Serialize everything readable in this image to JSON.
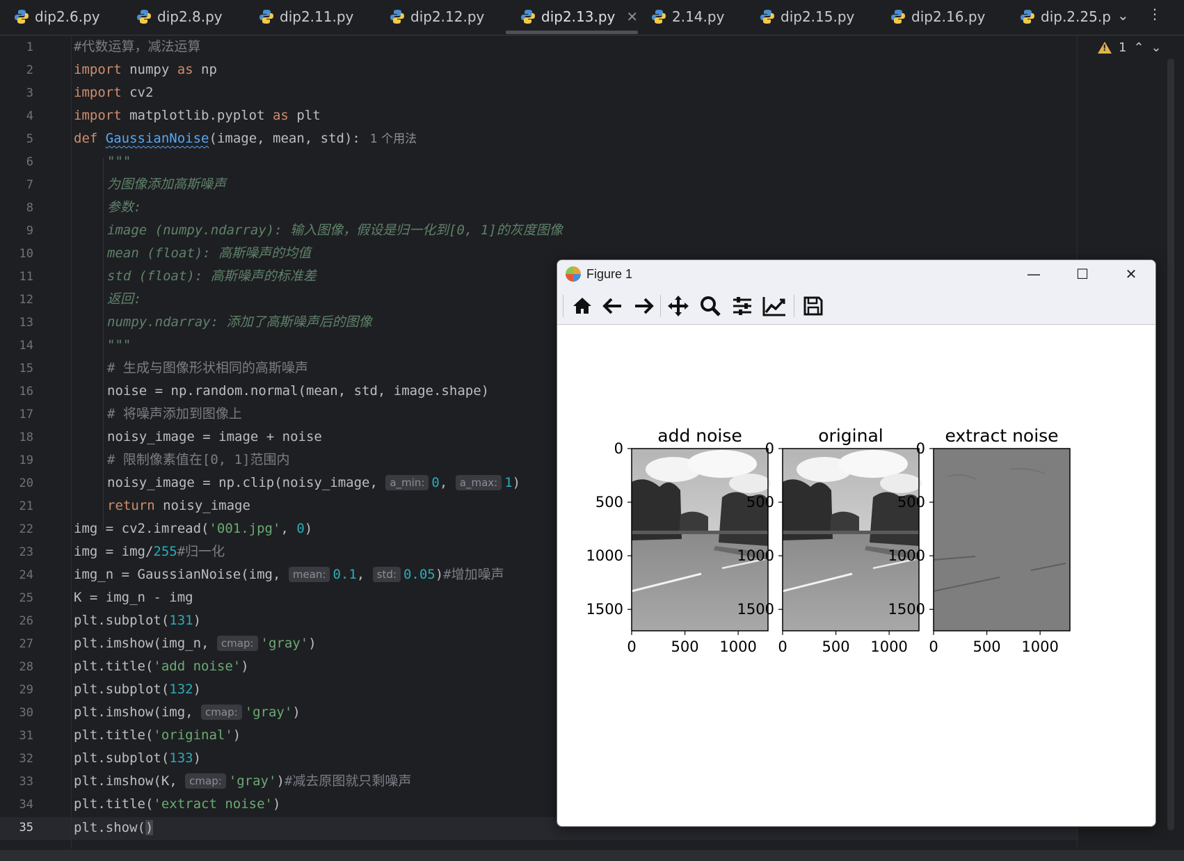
{
  "tabs": [
    {
      "label": "dip2.6.py",
      "active": false
    },
    {
      "label": "dip2.8.py",
      "active": false
    },
    {
      "label": "dip2.11.py",
      "active": false
    },
    {
      "label": "dip2.12.py",
      "active": false
    },
    {
      "label": "dip2.13.py",
      "active": true
    },
    {
      "label": "2.14.py",
      "active": false
    },
    {
      "label": "dip2.15.py",
      "active": false
    },
    {
      "label": "dip2.16.py",
      "active": false
    },
    {
      "label": "dip.2.25.p",
      "active": false
    }
  ],
  "line_numbers": [
    "1",
    "2",
    "3",
    "4",
    "5",
    "6",
    "7",
    "8",
    "9",
    "10",
    "11",
    "12",
    "13",
    "14",
    "15",
    "16",
    "17",
    "18",
    "19",
    "20",
    "21",
    "22",
    "23",
    "24",
    "25",
    "26",
    "27",
    "28",
    "29",
    "30",
    "31",
    "32",
    "33",
    "34",
    "35"
  ],
  "current_line": "35",
  "inspection": {
    "warning_count": "1"
  },
  "code": {
    "l1": "#代数运算，减法运算",
    "l2": [
      "import",
      " numpy ",
      "as",
      " np"
    ],
    "l3": [
      "import",
      " cv2"
    ],
    "l4": [
      "import",
      " matplotlib.pyplot ",
      "as",
      " plt"
    ],
    "l5": [
      "def",
      "GaussianNoise",
      "(image, mean, std):",
      "1 个用法"
    ],
    "l6": "\"\"\"",
    "l7": "为图像添加高斯噪声",
    "l8": "参数:",
    "l9": "image (numpy.ndarray): 输入图像，假设是归一化到[0, 1]的灰度图像",
    "l10": "mean (float): 高斯噪声的均值",
    "l11": "std (float): 高斯噪声的标准差",
    "l12": "返回:",
    "l13": "numpy.ndarray: 添加了高斯噪声后的图像",
    "l14": "\"\"\"",
    "l15": "# 生成与图像形状相同的高斯噪声",
    "l16": "noise = np.random.normal(mean, std, image.shape)",
    "l17": "# 将噪声添加到图像上",
    "l18": "noisy_image = image + noise",
    "l19": "# 限制像素值在[0, 1]范围内",
    "l20": [
      "noisy_image = np.clip(noisy_image, ",
      "a_min:",
      "0",
      ", ",
      "a_max:",
      "1",
      ")"
    ],
    "l21": [
      "return",
      " noisy_image"
    ],
    "l22": [
      "img = cv2.imread(",
      "'001.jpg'",
      ", ",
      "0",
      ")"
    ],
    "l23": [
      "img = img/",
      "255",
      "#归一化"
    ],
    "l24": [
      "img_n = GaussianNoise(img, ",
      "mean:",
      "0.1",
      ", ",
      "std:",
      "0.05",
      ")",
      "#增加噪声"
    ],
    "l25": "K = img_n - img",
    "l26": [
      "plt.subplot(",
      "131",
      ")"
    ],
    "l27": [
      "plt.imshow(img_n, ",
      "cmap:",
      "'gray'",
      ")"
    ],
    "l28": [
      "plt.title(",
      "'add noise'",
      ")"
    ],
    "l29": [
      "plt.subplot(",
      "132",
      ")"
    ],
    "l30": [
      "plt.imshow(img, ",
      "cmap:",
      "'gray'",
      ")"
    ],
    "l31": [
      "plt.title(",
      "'original'",
      ")"
    ],
    "l32": [
      "plt.subplot(",
      "133",
      ")"
    ],
    "l33": [
      "plt.imshow(K, ",
      "cmap:",
      "'gray'",
      ")",
      "#减去原图就只剩噪声"
    ],
    "l34": [
      "plt.title(",
      "'extract noise'",
      ")"
    ],
    "l35": [
      "plt.show(",
      ")"
    ]
  },
  "figure": {
    "title": "Figure 1",
    "toolbar": [
      "home-icon",
      "back-icon",
      "forward-icon",
      "pan-icon",
      "zoom-icon",
      "configure-subplots-icon",
      "edit-axis-icon",
      "save-icon"
    ],
    "window_buttons": {
      "minimize": "—",
      "maximize": "☐",
      "close": "✕"
    }
  },
  "chart_data": [
    {
      "type": "image",
      "title": "add noise",
      "xlim": [
        0,
        1280
      ],
      "ylim": [
        1700,
        0
      ],
      "xticks": [
        "0",
        "500",
        "1000"
      ],
      "yticks": [
        "0",
        "500",
        "1000",
        "1500"
      ],
      "cmap": "gray"
    },
    {
      "type": "image",
      "title": "original",
      "xlim": [
        0,
        1280
      ],
      "ylim": [
        1700,
        0
      ],
      "xticks": [
        "0",
        "500",
        "1000"
      ],
      "yticks": [
        "0",
        "500",
        "1000",
        "1500"
      ],
      "cmap": "gray"
    },
    {
      "type": "image",
      "title": "extract noise",
      "xlim": [
        0,
        1280
      ],
      "ylim": [
        1700,
        0
      ],
      "xticks": [
        "0",
        "500",
        "1000"
      ],
      "yticks": [
        "0",
        "500",
        "1000",
        "1500"
      ],
      "cmap": "gray"
    }
  ]
}
